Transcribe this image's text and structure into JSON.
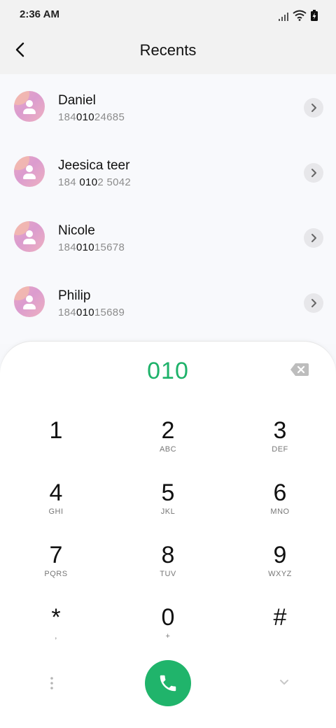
{
  "status_bar": {
    "time": "2:36 AM"
  },
  "header": {
    "title": "Recents"
  },
  "recents": [
    {
      "name": "Daniel",
      "number_pre": "184",
      "number_match": "010",
      "number_post": "24685"
    },
    {
      "name": "Jeesica teer",
      "number_pre": "184 ",
      "number_match": "010",
      "number_post": "2 5042"
    },
    {
      "name": "Nicole",
      "number_pre": "184",
      "number_match": "010",
      "number_post": "15678"
    },
    {
      "name": "Philip",
      "number_pre": "184",
      "number_match": "010",
      "number_post": "15689"
    }
  ],
  "dialpad": {
    "entered_number": "010",
    "keys": [
      {
        "digit": "1",
        "letters": ""
      },
      {
        "digit": "2",
        "letters": "ABC"
      },
      {
        "digit": "3",
        "letters": "DEF"
      },
      {
        "digit": "4",
        "letters": "GHI"
      },
      {
        "digit": "5",
        "letters": "JKL"
      },
      {
        "digit": "6",
        "letters": "MNO"
      },
      {
        "digit": "7",
        "letters": "PQRS"
      },
      {
        "digit": "8",
        "letters": "TUV"
      },
      {
        "digit": "9",
        "letters": "WXYZ"
      },
      {
        "digit": "*",
        "letters": ","
      },
      {
        "digit": "0",
        "letters": "+"
      },
      {
        "digit": "#",
        "letters": ""
      }
    ]
  },
  "colors": {
    "accent": "#1eb26a",
    "call_button": "#20b46b"
  }
}
